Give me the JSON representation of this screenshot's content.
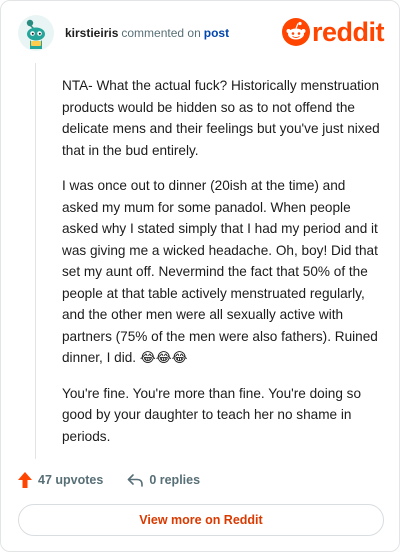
{
  "header": {
    "username": "kirstieiris",
    "verb": "commented on",
    "post_link": "post",
    "brand": "reddit"
  },
  "comment": {
    "paragraphs": [
      "NTA- What the actual fuck? Historically menstruation products would be hidden so as to not offend the delicate mens and their feelings but you've just nixed that in the bud entirely.",
      "I was once out to dinner (20ish at the time) and asked my mum for some panadol. When people asked why I stated simply that I had my period and it was giving me a wicked headache. Oh, boy! Did that set my aunt off. Nevermind the fact that 50% of the people at that table actively menstruated regularly, and the other men were all sexually active with partners (75% of the men were also fathers). Ruined dinner, I did. 😂😂😂",
      "You're fine. You're more than fine. You're doing so good by your daughter to teach her no shame in periods."
    ]
  },
  "actions": {
    "upvotes": "47 upvotes",
    "replies": "0 replies"
  },
  "footer": {
    "view_more": "View more on Reddit"
  },
  "colors": {
    "brand": "#ff4500",
    "link": "#0045ac",
    "view_more": "#d93a00",
    "avatar_bg": "#26a69a"
  }
}
